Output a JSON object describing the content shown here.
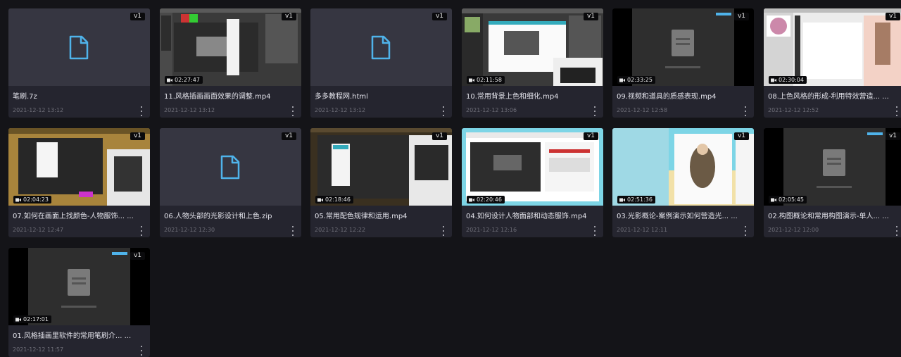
{
  "files": [
    {
      "kind": "file",
      "title": "笔刷.7z",
      "date": "2021-12-12 13:12",
      "version": "v1",
      "icon": "file-icon"
    },
    {
      "kind": "video",
      "title": "11.风格插画画面效果的调整.mp4",
      "date": "2021-12-12 13:12",
      "version": "v1",
      "duration": "02:27:47",
      "scene": "ps-dark"
    },
    {
      "kind": "file",
      "title": "多多教程网.html",
      "date": "2021-12-12 13:12",
      "version": "v1",
      "icon": "file-icon"
    },
    {
      "kind": "video",
      "title": "10.常用背景上色和细化.mp4",
      "date": "2021-12-12 13:06",
      "version": "v1",
      "duration": "02:11:58",
      "scene": "ps-dialog"
    },
    {
      "kind": "video",
      "title": "09.视频和道具的质感表现.mp4",
      "date": "2021-12-12 12:58",
      "version": "v1",
      "duration": "02:33:25",
      "scene": "tencent"
    },
    {
      "kind": "video",
      "title": "08.上色风格的形成-利用特效营造... ...",
      "date": "2021-12-12 12:52",
      "version": "v1",
      "duration": "02:30:04",
      "scene": "sai"
    },
    {
      "kind": "video",
      "title": "07.如何在画面上找颜色-人物服饰... ...",
      "date": "2021-12-12 12:47",
      "version": "v1",
      "duration": "02:04:23",
      "scene": "ps-gold"
    },
    {
      "kind": "file",
      "title": "06.人物头部的光影设计和上色.zip",
      "date": "2021-12-12 12:30",
      "version": "v1",
      "icon": "file-icon"
    },
    {
      "kind": "video",
      "title": "05.常用配色规律和运用.mp4",
      "date": "2021-12-12 12:22",
      "version": "v1",
      "duration": "02:18:46",
      "scene": "ps-panels"
    },
    {
      "kind": "video",
      "title": "04.如何设计人物面部和动态服饰.mp4",
      "date": "2021-12-12 12:16",
      "version": "v1",
      "duration": "02:20:46",
      "scene": "cyan-win"
    },
    {
      "kind": "video",
      "title": "03.光影概论-案例演示如何营造光... ...",
      "date": "2021-12-12 12:11",
      "version": "v1",
      "duration": "02:51:36",
      "scene": "illustration"
    },
    {
      "kind": "video",
      "title": "02.构图概论和常用构图演示-单人... ...",
      "date": "2021-12-12 12:00",
      "version": "v1",
      "duration": "02:05:45",
      "scene": "tencent"
    },
    {
      "kind": "video",
      "title": "01.风格插画里软件的常用笔刷介... ...",
      "date": "2021-12-12 11:57",
      "version": "v1",
      "duration": "02:17:01",
      "scene": "tencent"
    }
  ],
  "ui": {
    "more_icon": "more-vertical-icon",
    "video_icon": "video-camera-icon",
    "accent": "#4fb3ea",
    "background": "#141418",
    "card_background": "#25252f"
  }
}
